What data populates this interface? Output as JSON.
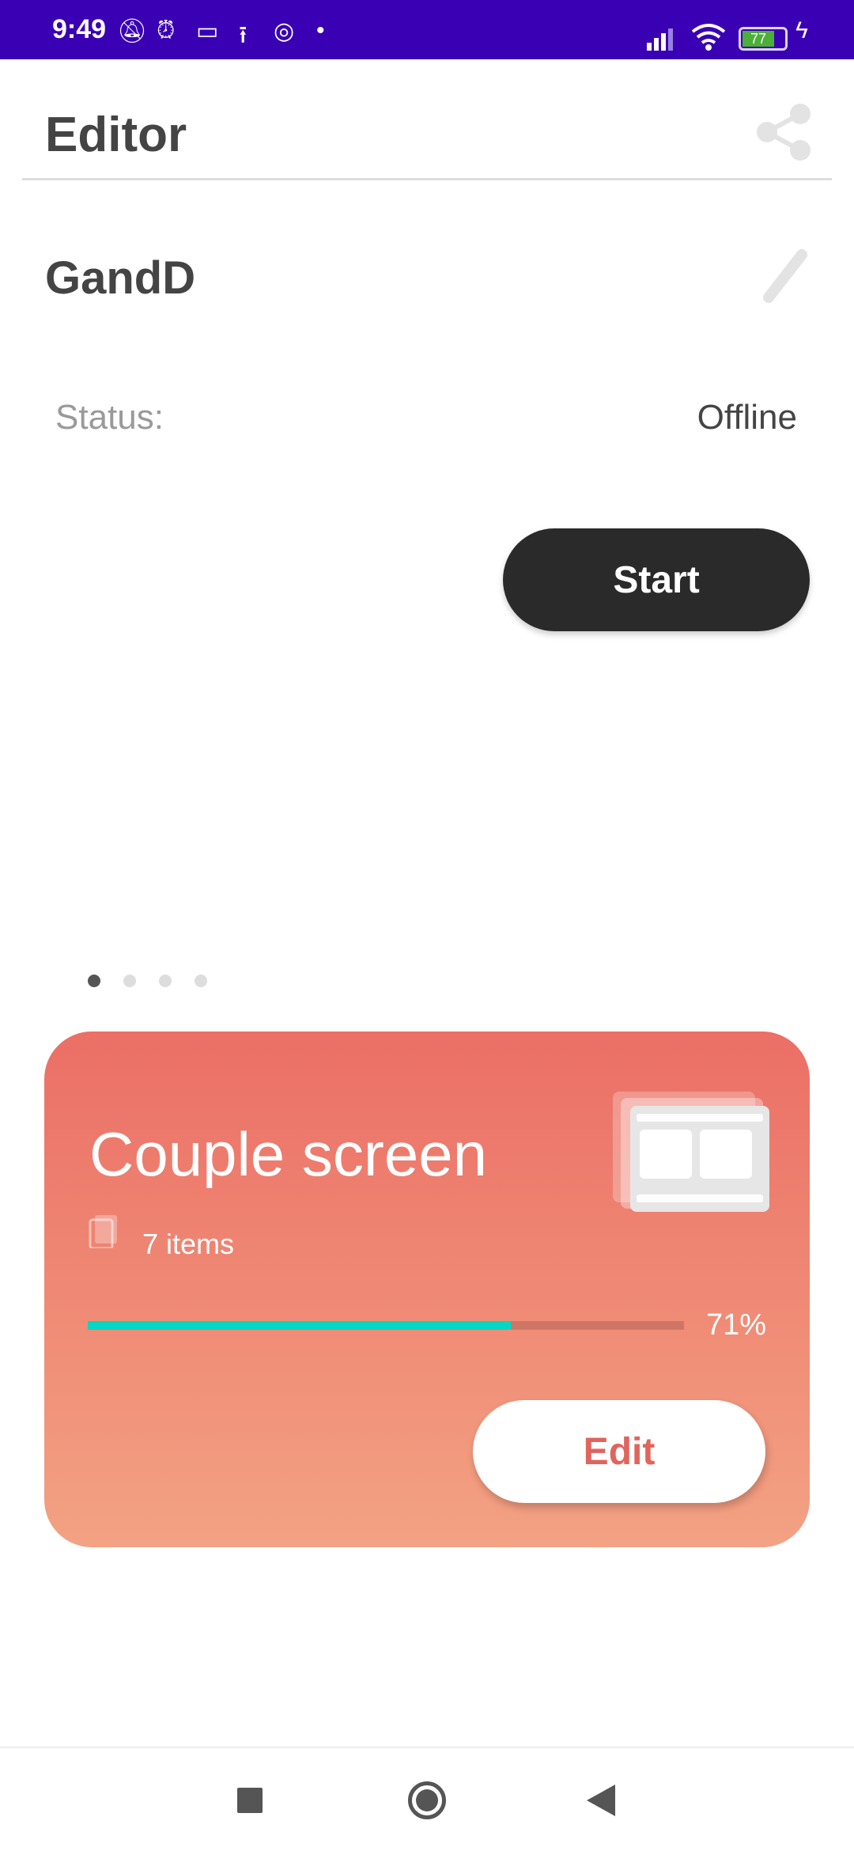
{
  "status_bar": {
    "time": "9:49",
    "battery": "77",
    "bg_color": "#3a00b4"
  },
  "header": {
    "title": "Editor",
    "share_icon": "share-icon"
  },
  "project": {
    "name": "GandD",
    "edit_icon": "pencil-icon",
    "status_label": "Status:",
    "status_value": "Offline",
    "start_label": "Start"
  },
  "pager": {
    "pages": 4,
    "active": 0
  },
  "card": {
    "title": "Couple screen",
    "items": "7 items",
    "progress_percent": 71,
    "progress_label": "71%",
    "edit_label": "Edit",
    "gradient": [
      "#eb6f66",
      "#f3a283"
    ],
    "progress_color": "#06d6c4"
  },
  "navbar": {
    "icons": [
      "recents-square-icon",
      "home-circle-icon",
      "back-triangle-icon"
    ]
  }
}
